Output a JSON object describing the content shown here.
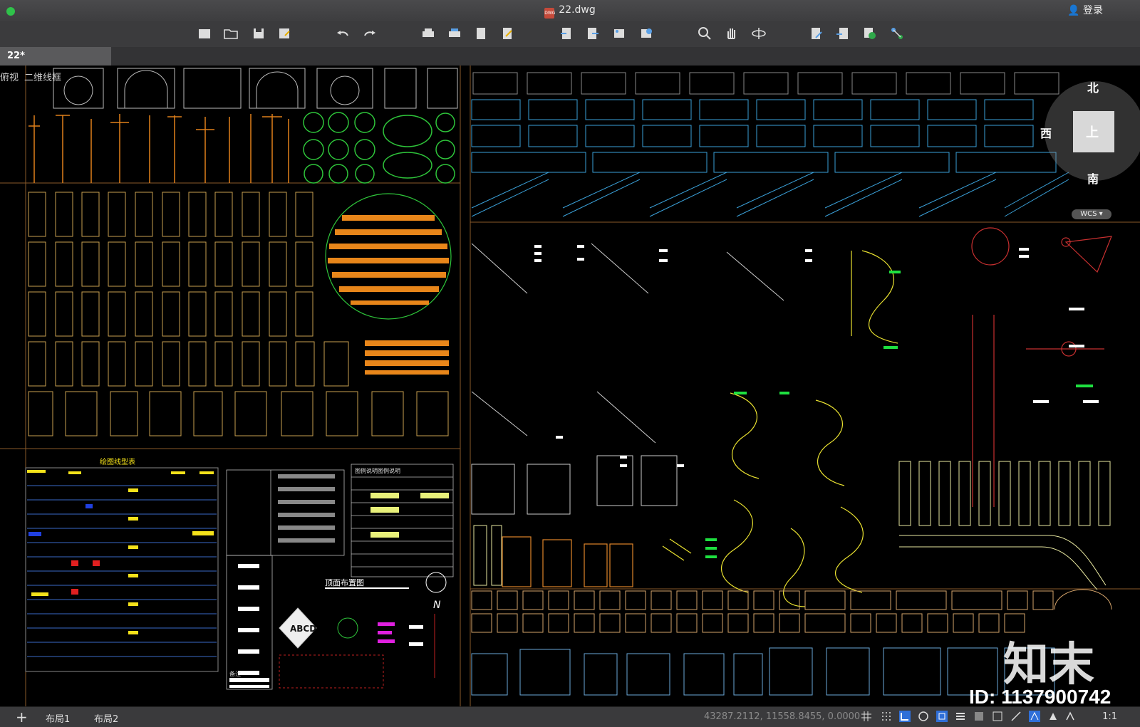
{
  "window": {
    "title": "22.dwg",
    "login_label": "登录"
  },
  "tabs": [
    {
      "label": "22*"
    }
  ],
  "view": {
    "mode": "俯视",
    "style": "二维线框"
  },
  "viewcube": {
    "north": "北",
    "south": "南",
    "west": "西",
    "top": "上",
    "wcs": "WCS"
  },
  "drawing_labels": {
    "linetype_table": "绘图线型表",
    "ceiling_plan": "顶面布置图",
    "north_arrow": "N",
    "legend_header": "图例说明图例说明",
    "symbol_abcd": "ABCD",
    "remark": "备注"
  },
  "status": {
    "coordinates": "43287.2112, 11558.8455, 0.0000",
    "layouts": [
      "布局1",
      "布局2"
    ],
    "scale": "1:1"
  },
  "overlay": {
    "brand": "知末",
    "id": "ID: 1137900742"
  },
  "colors": {
    "accent_green": "#2fc24a",
    "cad_bg": "#000000"
  }
}
